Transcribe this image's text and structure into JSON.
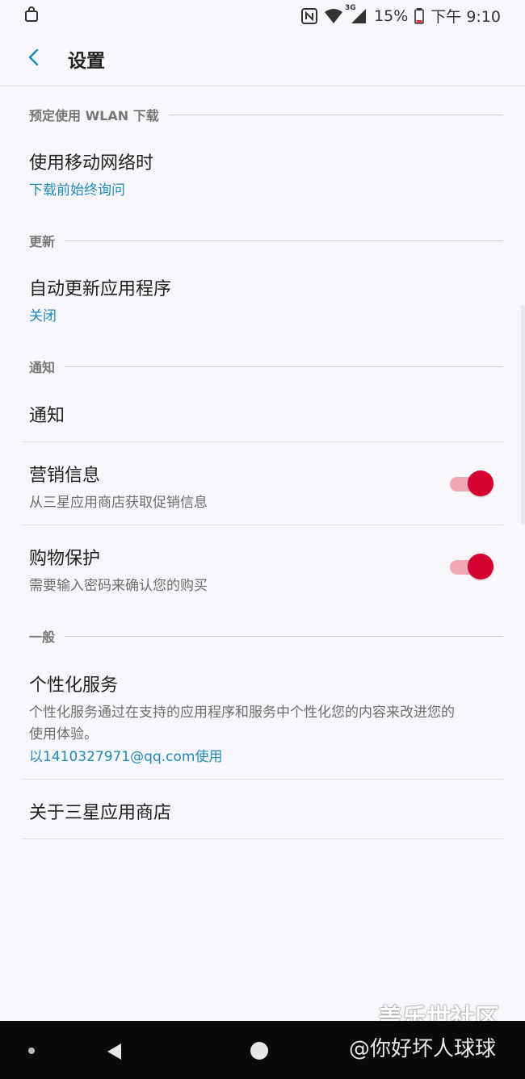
{
  "status": {
    "battery": "15%",
    "time": "下午 9:10",
    "network": "3G"
  },
  "appbar": {
    "title": "设置"
  },
  "sections": {
    "wlan": {
      "header": "预定使用 WLAN 下载",
      "item_title": "使用移动网络时",
      "item_value": "下载前始终询问"
    },
    "update": {
      "header": "更新",
      "item_title": "自动更新应用程序",
      "item_value": "关闭"
    },
    "notify": {
      "header": "通知",
      "notifications_title": "通知",
      "marketing_title": "营销信息",
      "marketing_sub": "从三星应用商店获取促销信息",
      "marketing_on": true,
      "shopping_title": "购物保护",
      "shopping_sub": "需要输入密码来确认您的购买",
      "shopping_on": true
    },
    "general": {
      "header": "一般",
      "personal_title": "个性化服务",
      "personal_desc_line1": "个性化服务通过在支持的应用程序和服务中个性化您的内容来改进您的",
      "personal_desc_line2": "使用体验。",
      "personal_account": "以1410327971@qq.com使用",
      "about_title": "关于三星应用商店"
    }
  },
  "watermark": {
    "site": "盖乐世社区",
    "user": "@你好坏人球球"
  },
  "colors": {
    "accent": "#1f8bb8",
    "toggle_on": "#d4002e",
    "toggle_track": "#f0a8b6"
  }
}
